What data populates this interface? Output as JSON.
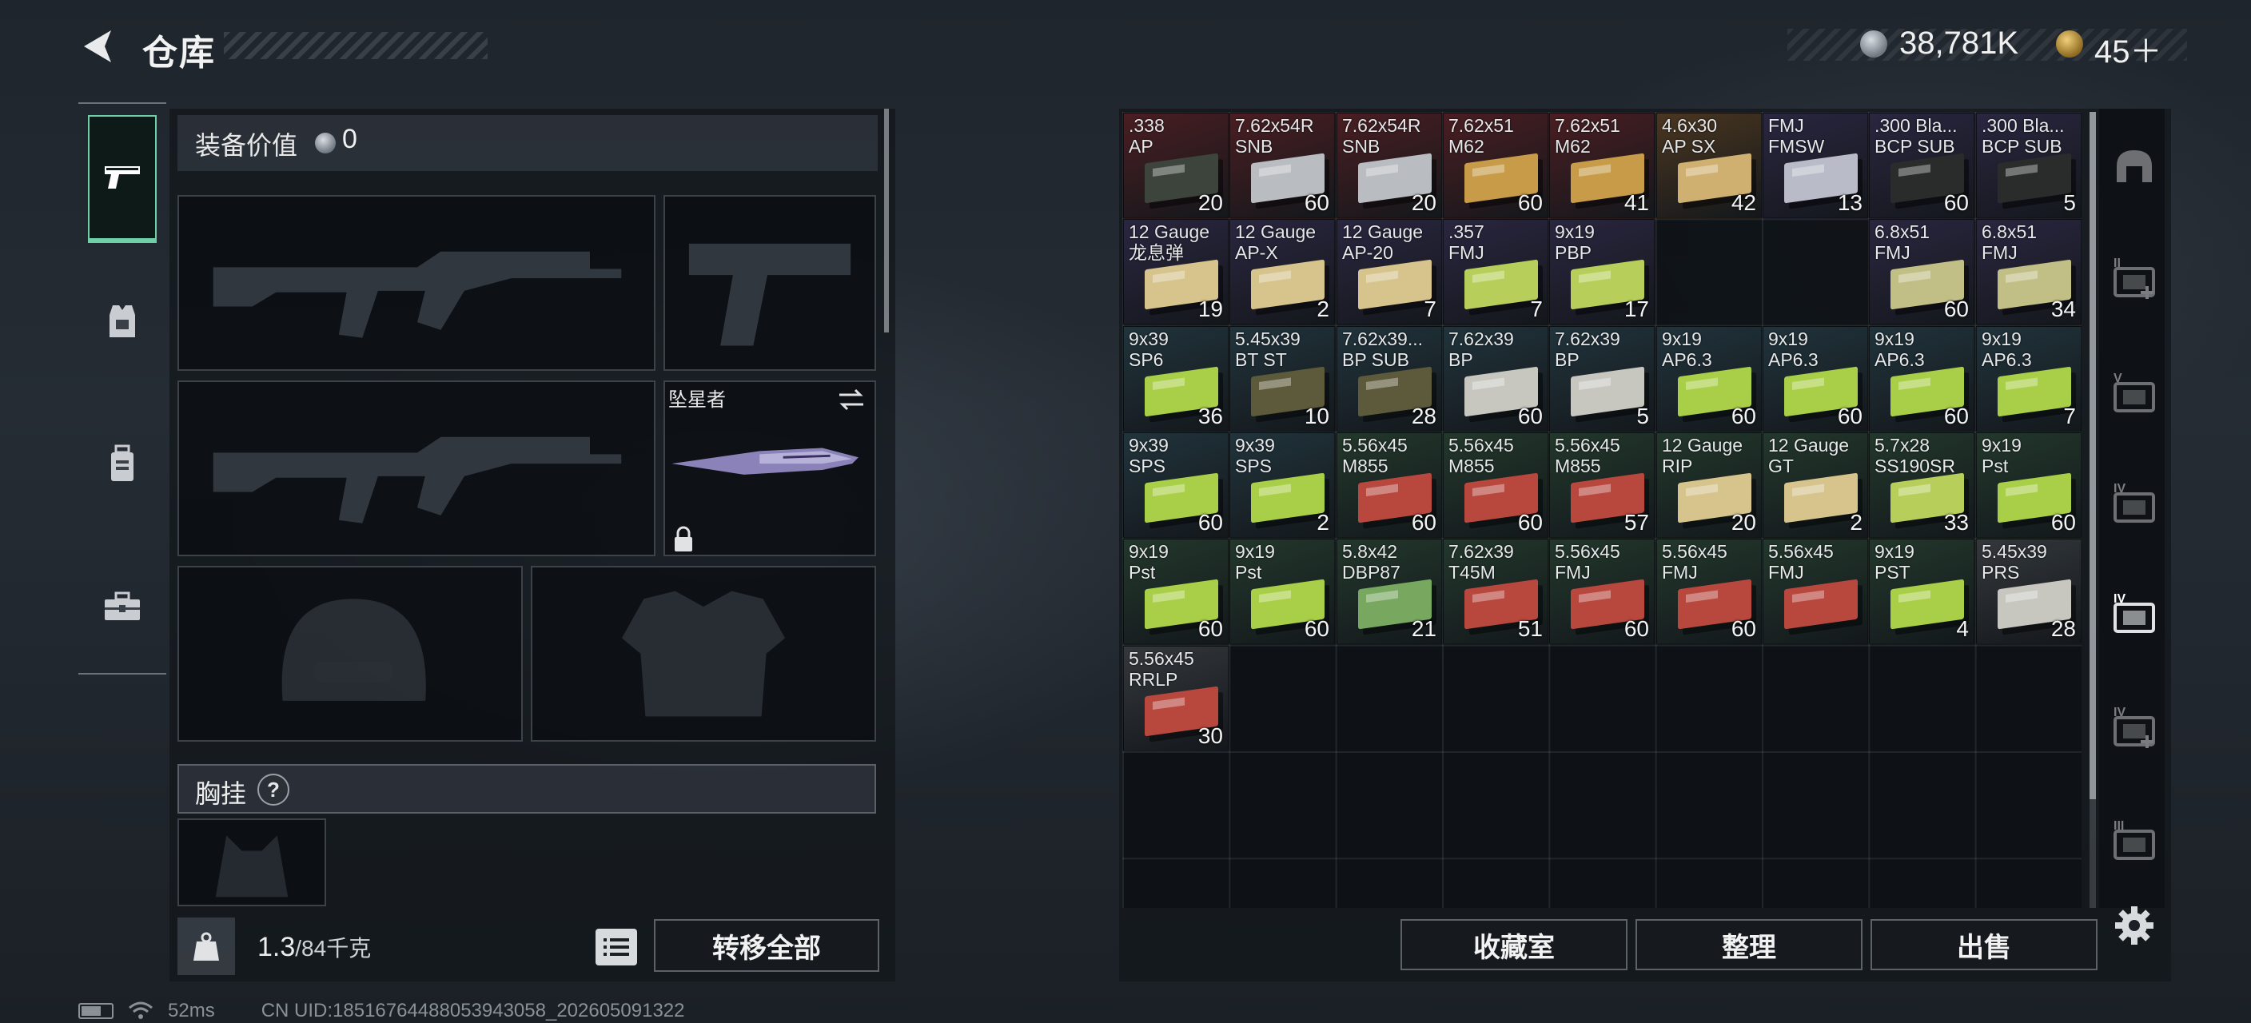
{
  "header": {
    "title": "仓库",
    "currency": {
      "coins": "38,781K",
      "bonds": "45＋"
    }
  },
  "left_rail": {
    "items": [
      {
        "name": "weapons",
        "icon": "pistol-icon",
        "active": true
      },
      {
        "name": "armor",
        "icon": "vest-icon",
        "active": false
      },
      {
        "name": "rig",
        "icon": "backpack-icon",
        "active": false
      },
      {
        "name": "tools",
        "icon": "toolbox-icon",
        "active": false
      }
    ]
  },
  "equipment": {
    "value_label": "装备价值",
    "value": "0",
    "melee_name": "坠星者",
    "vest_label": "胸挂",
    "vest_help": "?",
    "weight": "1.3",
    "weight_max": "/84千克",
    "transfer_label": "转移全部"
  },
  "storage": {
    "rows": [
      [
        {
          "name": ".338\nAP",
          "count": "20",
          "bg": "#4a1e22",
          "box": "#3c443c"
        },
        {
          "name": "7.62x54R\nSNB",
          "count": "60",
          "bg": "#4a1e22",
          "box": "#b9bcc0"
        },
        {
          "name": "7.62x54R\nSNB",
          "count": "20",
          "bg": "#4a1e22",
          "box": "#b9bcc0"
        },
        {
          "name": "7.62x51\nM62",
          "count": "60",
          "bg": "#4a1e22",
          "box": "#c79b48"
        },
        {
          "name": "7.62x51\nM62",
          "count": "41",
          "bg": "#4a1e22",
          "box": "#c79b48"
        },
        {
          "name": "4.6x30\nAP SX",
          "count": "42",
          "bg": "#4a3620",
          "box": "#cfb070"
        },
        {
          "name": "FMJ\nFMSW",
          "count": "13",
          "bg": "#2a2640",
          "box": "#b9bcc8"
        },
        {
          "name": ".300 Bla...\nBCP SUB",
          "count": "60",
          "bg": "#2a2640",
          "box": "#2a2c2c"
        },
        {
          "name": ".300 Bla...\nBCP SUB",
          "count": "5",
          "bg": "#2a2640",
          "box": "#2a2c2c"
        }
      ],
      [
        {
          "name": "12 Gauge\n龙息弹",
          "count": "19",
          "bg": "#2a2640",
          "box": "#d6c48c"
        },
        {
          "name": "12 Gauge\nAP-X",
          "count": "2",
          "bg": "#2a2640",
          "box": "#d6c48c"
        },
        {
          "name": "12 Gauge\nAP-20",
          "count": "7",
          "bg": "#2a2640",
          "box": "#d6c48c"
        },
        {
          "name": ".357\nFMJ",
          "count": "7",
          "bg": "#2a2640",
          "box": "#b7cf5a"
        },
        {
          "name": "9x19\nPBP",
          "count": "17",
          "bg": "#2a2640",
          "box": "#b7cf5a"
        },
        null,
        null,
        {
          "name": "6.8x51\nFMJ",
          "count": "60",
          "bg": "#2a2640",
          "box": "#c2bf86"
        },
        {
          "name": "6.8x51\nFMJ",
          "count": "34",
          "bg": "#2a2640",
          "box": "#c2bf86"
        }
      ],
      [
        {
          "name": "9x39\nSP6",
          "count": "36",
          "bg": "#21343c",
          "box": "#a9cf48"
        },
        {
          "name": "5.45x39\nBT ST",
          "count": "10",
          "bg": "#21343c",
          "box": "#5c5a3a"
        },
        {
          "name": "7.62x39...\nBP SUB",
          "count": "28",
          "bg": "#21343c",
          "box": "#5c5a3a"
        },
        {
          "name": "7.62x39\nBP",
          "count": "60",
          "bg": "#21343c",
          "box": "#c7c7c0"
        },
        {
          "name": "7.62x39\nBP",
          "count": "5",
          "bg": "#21343c",
          "box": "#c7c7c0"
        },
        {
          "name": "9x19\nAP6.3",
          "count": "60",
          "bg": "#21343c",
          "box": "#a9cf48"
        },
        {
          "name": "9x19\nAP6.3",
          "count": "60",
          "bg": "#21343c",
          "box": "#a9cf48"
        },
        {
          "name": "9x19\nAP6.3",
          "count": "60",
          "bg": "#21343c",
          "box": "#a9cf48"
        },
        {
          "name": "9x19\nAP6.3",
          "count": "7",
          "bg": "#21343c",
          "box": "#a9cf48"
        }
      ],
      [
        {
          "name": "9x39\nSPS",
          "count": "60",
          "bg": "#21343c",
          "box": "#a9cf48"
        },
        {
          "name": "9x39\nSPS",
          "count": "2",
          "bg": "#21343c",
          "box": "#a9cf48"
        },
        {
          "name": "5.56x45\nM855",
          "count": "60",
          "bg": "#23382c",
          "box": "#b8483e"
        },
        {
          "name": "5.56x45\nM855",
          "count": "60",
          "bg": "#23382c",
          "box": "#b8483e"
        },
        {
          "name": "5.56x45\nM855",
          "count": "57",
          "bg": "#23382c",
          "box": "#b8483e"
        },
        {
          "name": "12 Gauge\nRIP",
          "count": "20",
          "bg": "#23382c",
          "box": "#d6c48c"
        },
        {
          "name": "12 Gauge\nGT",
          "count": "2",
          "bg": "#23382c",
          "box": "#d6c48c"
        },
        {
          "name": "5.7x28\nSS190SR",
          "count": "33",
          "bg": "#23382c",
          "box": "#b7cf5a"
        },
        {
          "name": "9x19\nPst",
          "count": "60",
          "bg": "#23382c",
          "box": "#a9cf48"
        }
      ],
      [
        {
          "name": "9x19\nPst",
          "count": "60",
          "bg": "#23382c",
          "box": "#a9cf48"
        },
        {
          "name": "9x19\nPst",
          "count": "60",
          "bg": "#23382c",
          "box": "#a9cf48"
        },
        {
          "name": "5.8x42\nDBP87",
          "count": "21",
          "bg": "#23382c",
          "box": "#78a860"
        },
        {
          "name": "7.62x39\nT45M",
          "count": "51",
          "bg": "#23382c",
          "box": "#b8483e"
        },
        {
          "name": "5.56x45\nFMJ",
          "count": "60",
          "bg": "#23382c",
          "box": "#b8483e"
        },
        {
          "name": "5.56x45\nFMJ",
          "count": "60",
          "bg": "#23382c",
          "box": "#b8483e"
        },
        {
          "name": "5.56x45\nFMJ",
          "count": "",
          "bg": "#23382c",
          "box": "#b8483e"
        },
        {
          "name": "9x19\nPST",
          "count": "4",
          "bg": "#23382c",
          "box": "#a9cf48"
        },
        {
          "name": "5.45x39\nPRS",
          "count": "28",
          "bg": "#34383c",
          "box": "#c7c7c0"
        }
      ],
      [
        {
          "name": "5.56x45\nRRLP",
          "count": "30",
          "bg": "#34383c",
          "box": "#b8483e"
        },
        null,
        null,
        null,
        null,
        null,
        null,
        null,
        null
      ]
    ],
    "collection_label": "收藏室",
    "organize_label": "整理",
    "sell_label": "出售"
  },
  "page_rail": {
    "pages": [
      {
        "icon": "helmet-icon",
        "label": ""
      },
      {
        "icon": "add-storage-icon",
        "label": "II"
      },
      {
        "icon": "storage-v-icon",
        "label": "V"
      },
      {
        "icon": "storage-iv-icon",
        "label": "IV"
      },
      {
        "icon": "folder-storage-icon",
        "label": "IV"
      },
      {
        "icon": "add-storage-icon",
        "label": "IV"
      },
      {
        "icon": "storage-iii-icon",
        "label": "III"
      }
    ]
  },
  "status": {
    "ping": "52ms",
    "uid": "CN UID:18516764488053943058_202605091322"
  }
}
